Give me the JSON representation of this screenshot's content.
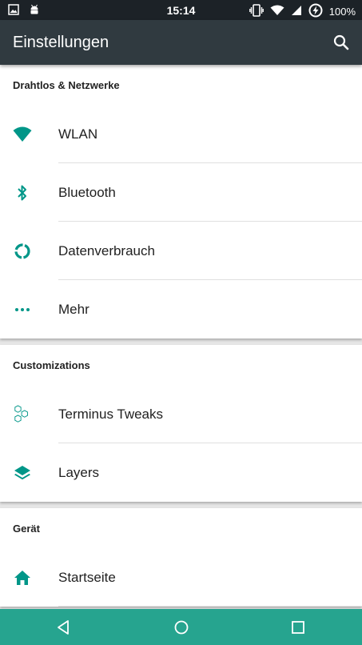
{
  "status_bar": {
    "time": "15:14",
    "battery_text": "100%",
    "icons": [
      "image-icon",
      "android-icon",
      "vibrate-icon",
      "wifi-icon",
      "signal-icon",
      "battery-charging-icon"
    ]
  },
  "app_bar": {
    "title": "Einstellungen",
    "search_icon": "search-icon"
  },
  "sections": [
    {
      "header": "Drahtlos & Netzwerke",
      "items": [
        {
          "label": "WLAN",
          "icon": "wifi-icon"
        },
        {
          "label": "Bluetooth",
          "icon": "bluetooth-icon"
        },
        {
          "label": "Datenverbrauch",
          "icon": "data-usage-icon"
        },
        {
          "label": "Mehr",
          "icon": "more-icon"
        }
      ]
    },
    {
      "header": "Customizations",
      "items": [
        {
          "label": "Terminus Tweaks",
          "icon": "hexagons-icon"
        },
        {
          "label": "Layers",
          "icon": "layers-icon"
        }
      ]
    },
    {
      "header": "Gerät",
      "items": [
        {
          "label": "Startseite",
          "icon": "home-icon"
        }
      ]
    }
  ],
  "nav_bar": {
    "icons": [
      "back-icon",
      "home-circle-icon",
      "recents-icon"
    ]
  },
  "colors": {
    "accent": "#009688",
    "app_bar": "#303a40",
    "status_bar": "#1c2227",
    "nav_bar": "#26a48f"
  }
}
